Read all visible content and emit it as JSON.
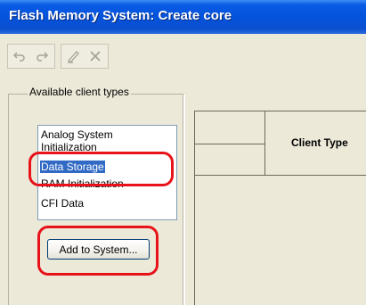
{
  "window": {
    "title": "Flash Memory System: Create core"
  },
  "toolbar": {
    "buttons": [
      {
        "name": "undo-icon"
      },
      {
        "name": "redo-icon"
      },
      {
        "name": "edit-icon"
      },
      {
        "name": "delete-icon"
      }
    ]
  },
  "client_types": {
    "legend": "Available client types",
    "items": [
      {
        "label": "Analog System",
        "selected": false
      },
      {
        "label": "Initialization",
        "selected": false
      },
      {
        "label": "Data Storage",
        "selected": true
      },
      {
        "label": "RAM Initialization",
        "selected": false
      },
      {
        "label": "CFI Data",
        "selected": false
      }
    ],
    "add_button_label": "Add to System..."
  },
  "grid": {
    "column_header": "Client Type"
  },
  "colors": {
    "title_bar": "#0453dc",
    "selection": "#316ac5",
    "highlight": "#e8121a"
  }
}
